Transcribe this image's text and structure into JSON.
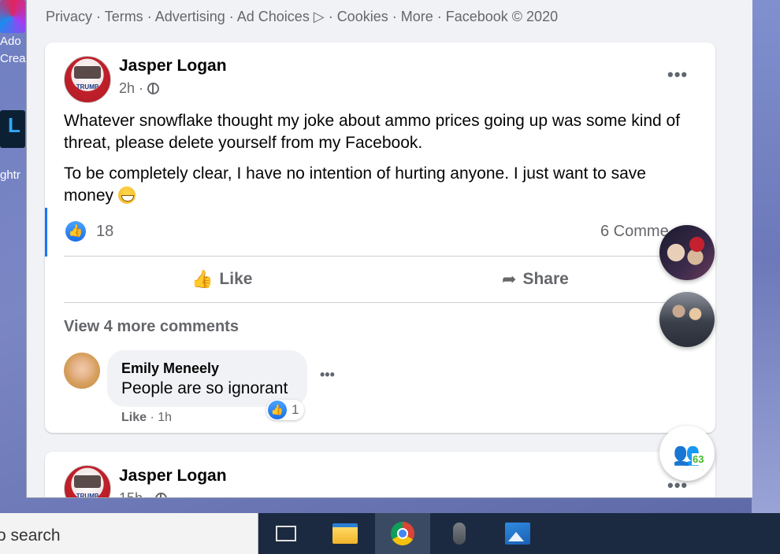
{
  "desktop": {
    "icons": [
      {
        "label_line1": "Ado",
        "label_line2": "Crea"
      },
      {
        "label_line1": "L",
        "label_line2": "ghtr"
      }
    ]
  },
  "footer": {
    "links": [
      "Privacy",
      "Terms",
      "Advertising",
      "Ad Choices",
      "Cookies",
      "More"
    ],
    "separator": " · ",
    "adchoices_icon": "ad-choices-icon",
    "copyright": "Facebook © 2020"
  },
  "post1": {
    "author": "Jasper Logan",
    "avatar_text": "TRUMP",
    "time": "2h",
    "privacy_icon": "globe-icon",
    "paragraph1": "Whatever snowflake thought my joke about ammo prices going up was some kind of threat, please delete yourself from my Facebook.",
    "paragraph2": "To be completely clear, I have no intention of hurting anyone. I just want to save money",
    "emoji": "grinning-face",
    "likes": "18",
    "comments_count": "6 Comme",
    "like_label": "Like",
    "share_label": "Share",
    "view_more": "View 4 more comments",
    "comment": {
      "name": "Emily Meneely",
      "text": "People are so ignorant",
      "reaction_count": "1",
      "like_action": "Like",
      "time": "1h"
    }
  },
  "post2": {
    "author": "Jasper Logan",
    "time": "15h"
  },
  "chat": {
    "online_count": "63"
  },
  "taskbar": {
    "search_text": "o search",
    "apps": [
      "task-view",
      "file-explorer",
      "chrome",
      "microphone",
      "photos"
    ]
  },
  "colors": {
    "facebook_blue": "#1877f2",
    "online_green": "#42b72a",
    "taskbar": "#1b2a40"
  }
}
